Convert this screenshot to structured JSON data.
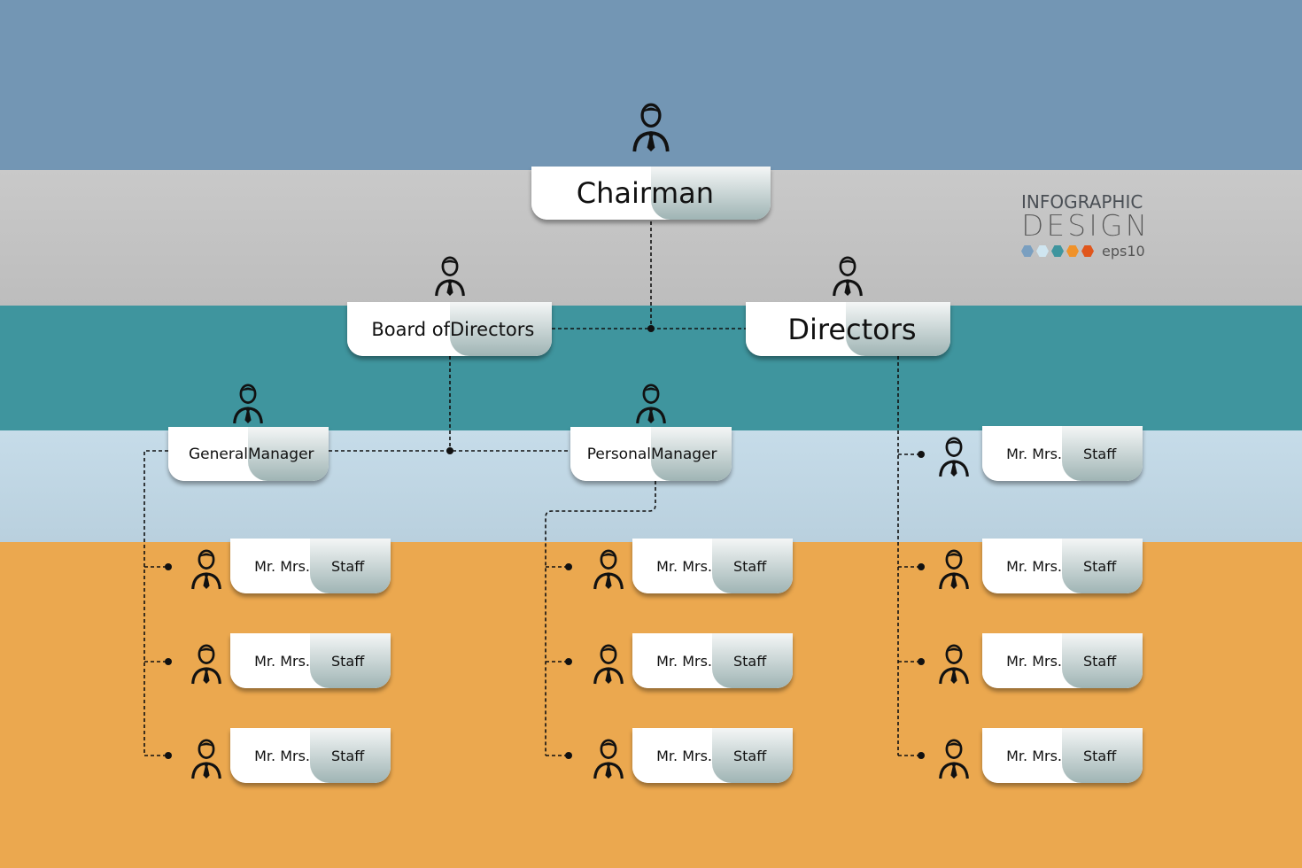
{
  "colors": {
    "band_top": "#7396b4",
    "band_gray": "#c4c4c4",
    "band_teal": "#3f959e",
    "band_light": "#c2d9e6",
    "band_orange": "#eba84f"
  },
  "logo": {
    "line1": "INFOGRAPHIC",
    "line2": "DESIGN",
    "tag": "eps10",
    "dot_colors": [
      "#7a9fc0",
      "#cfe5f0",
      "#3f959e",
      "#f0922a",
      "#e0561c"
    ]
  },
  "nodes": {
    "chairman": {
      "left": "Chair",
      "right": "man"
    },
    "board": {
      "left": "Board of ",
      "right": "Directors"
    },
    "directors": {
      "left": "Dire",
      "right": "ctors"
    },
    "general_manager": {
      "left": "General ",
      "right": "Manager"
    },
    "personal_manager": {
      "left": "Personal ",
      "right": "Manager"
    }
  },
  "staff": {
    "name": "Mr. Mrs.",
    "role": "Staff",
    "groups": [
      {
        "manager": "General Manager",
        "count": 3
      },
      {
        "manager": "Personal Manager",
        "count": 3
      },
      {
        "manager": "Directors",
        "count": 4
      }
    ]
  }
}
